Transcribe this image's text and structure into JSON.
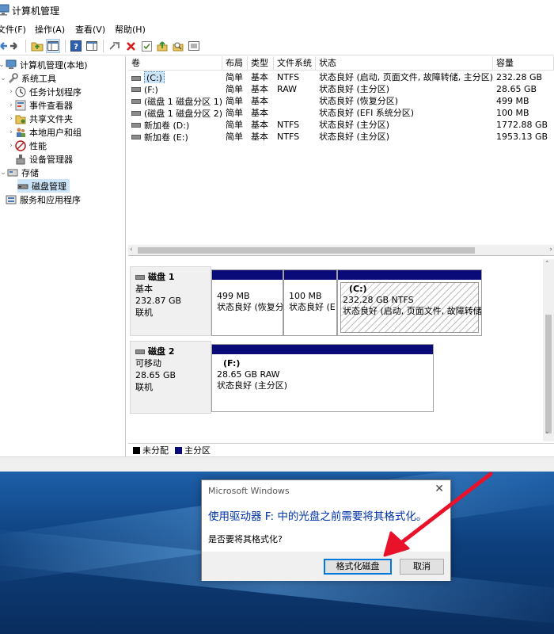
{
  "window": {
    "title": "计算机管理"
  },
  "menu": [
    "文件(F)",
    "操作(A)",
    "查看(V)",
    "帮助(H)"
  ],
  "tree": {
    "root": "计算机管理(本地)",
    "system_tools": "系统工具",
    "task_scheduler": "任务计划程序",
    "event_viewer": "事件查看器",
    "shared_folders": "共享文件夹",
    "local_users": "本地用户和组",
    "performance": "性能",
    "device_manager": "设备管理器",
    "storage": "存储",
    "disk_management": "磁盘管理",
    "services_apps": "服务和应用程序"
  },
  "columns": [
    "卷",
    "布局",
    "类型",
    "文件系统",
    "状态",
    "容量"
  ],
  "volumes": [
    {
      "name": "(C:)",
      "layout": "简单",
      "type": "基本",
      "fs": "NTFS",
      "status": "状态良好 (启动, 页面文件, 故障转储, 主分区)",
      "capacity": "232.28 GB"
    },
    {
      "name": "(F:)",
      "layout": "简单",
      "type": "基本",
      "fs": "RAW",
      "status": "状态良好 (主分区)",
      "capacity": "28.65 GB"
    },
    {
      "name": "(磁盘 1 磁盘分区 1)",
      "layout": "简单",
      "type": "基本",
      "fs": "",
      "status": "状态良好 (恢复分区)",
      "capacity": "499 MB"
    },
    {
      "name": "(磁盘 1 磁盘分区 2)",
      "layout": "简单",
      "type": "基本",
      "fs": "",
      "status": "状态良好 (EFI 系统分区)",
      "capacity": "100 MB"
    },
    {
      "name": "新加卷 (D:)",
      "layout": "简单",
      "type": "基本",
      "fs": "NTFS",
      "status": "状态良好 (主分区)",
      "capacity": "1772.88 GB"
    },
    {
      "name": "新加卷 (E:)",
      "layout": "简单",
      "type": "基本",
      "fs": "NTFS",
      "status": "状态良好 (主分区)",
      "capacity": "1953.13 GB"
    }
  ],
  "disks": [
    {
      "name": "磁盘 1",
      "kind": "基本",
      "size": "232.87 GB",
      "state": "联机",
      "partitions": [
        {
          "title": "",
          "line1": "499 MB",
          "line2": "状态良好 (恢复分"
        },
        {
          "title": "",
          "line1": "100 MB",
          "line2": "状态良好 (E"
        },
        {
          "title": "(C:)",
          "line1": "232.28 GB NTFS",
          "line2": "状态良好 (启动, 页面文件, 故障转储"
        }
      ]
    },
    {
      "name": "磁盘 2",
      "kind": "可移动",
      "size": "28.65 GB",
      "state": "联机",
      "partitions": [
        {
          "title": "(F:)",
          "line1": "28.65 GB RAW",
          "line2": "状态良好 (主分区)"
        }
      ]
    }
  ],
  "legend": {
    "unallocated": "未分配",
    "primary": "主分区"
  },
  "dialog": {
    "title": "Microsoft Windows",
    "message": "使用驱动器 F: 中的光盘之前需要将其格式化。",
    "question": "是否要将其格式化?",
    "format_button": "格式化磁盘",
    "cancel_button": "取消"
  },
  "colors": {
    "partition_bar": "#0a0a78",
    "unallocated": "#000000",
    "annotation_arrow": "#e8122a",
    "dialog_message": "#0033aa"
  }
}
